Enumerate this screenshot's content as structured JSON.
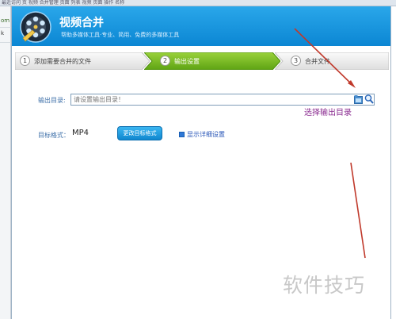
{
  "background": {
    "top_strip_text": "最近访问 页   视频 合并管理 页面 列表   视频 页面 操作 名称",
    "left_fragments": [
      "om",
      "k"
    ]
  },
  "app": {
    "title": "视频合并",
    "subtitle": "帮助多媒体工具·专业、简用、免费的多媒体工具",
    "logo_icon": "film-reel-icon",
    "header_color": "#1a97e0"
  },
  "steps": [
    {
      "num": "1",
      "label": "添加需要合并的文件",
      "state": "done"
    },
    {
      "num": "2",
      "label": "输出设置",
      "state": "active"
    },
    {
      "num": "3",
      "label": "合并文件",
      "state": "pending"
    }
  ],
  "output": {
    "label": "输出目录:",
    "placeholder": "请设置输出目录！",
    "folder_icon": "folder-icon",
    "search_icon": "search-icon"
  },
  "annotation": {
    "hint": "选择输出目录",
    "hint_color": "#8a2b90",
    "arrow_color": "#c0392b"
  },
  "format": {
    "label": "目标格式：",
    "value": "MP4",
    "change_button": "更改目标格式",
    "detail_link": "显示详细设置",
    "detail_icon": "settings-grid-icon"
  },
  "watermark": "软件技巧"
}
